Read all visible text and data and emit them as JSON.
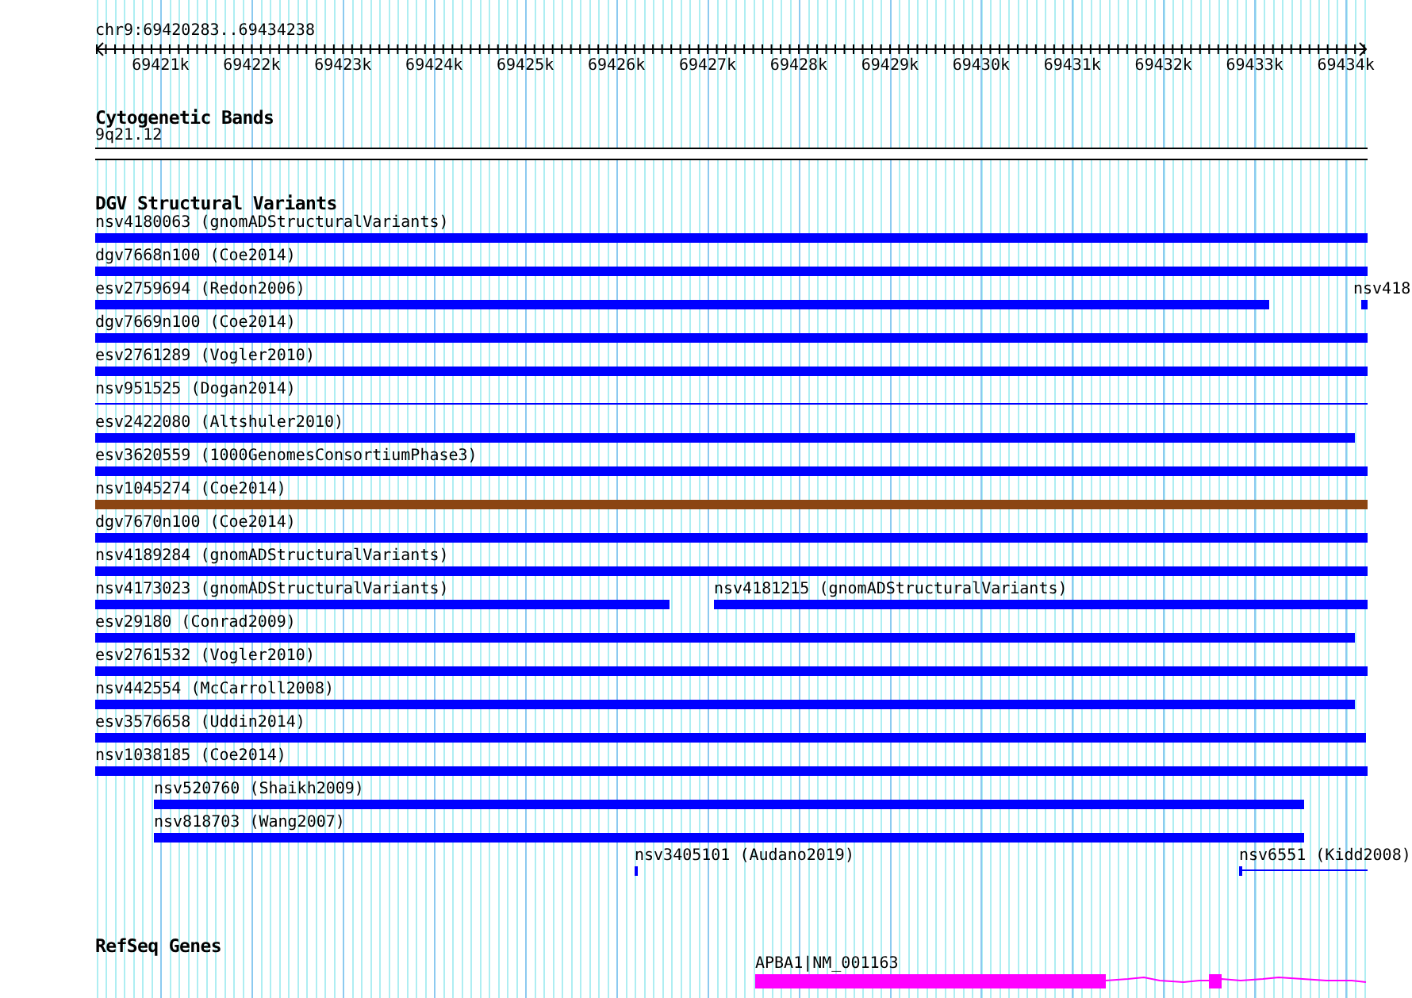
{
  "ruler": {
    "location": "chr9:69420283..69434238",
    "tick_labels": [
      "69421k",
      "69422k",
      "69423k",
      "69424k",
      "69425k",
      "69426k",
      "69427k",
      "69428k",
      "69429k",
      "69430k",
      "69431k",
      "69432k",
      "69433k",
      "69434k"
    ]
  },
  "cytogenetic_bands": {
    "title": "Cytogenetic Bands",
    "band_label": "9q21.12"
  },
  "dgv_structural_variants": {
    "title": "DGV Structural Variants",
    "rows": [
      {
        "features": [
          {
            "label": "nsv4180063 (gnomADStructuralVariants)",
            "kind": "bar",
            "color": "#0000ff"
          }
        ]
      },
      {
        "features": [
          {
            "label": "dgv7668n100 (Coe2014)",
            "kind": "bar",
            "color": "#0000ff"
          }
        ]
      },
      {
        "features": [
          {
            "label": "esv2759694 (Redon2006)",
            "kind": "bar",
            "color": "#0000ff"
          },
          {
            "label": "nsv418",
            "kind": "bar",
            "color": "#0000ff"
          }
        ]
      },
      {
        "features": [
          {
            "label": "dgv7669n100 (Coe2014)",
            "kind": "bar",
            "color": "#0000ff"
          }
        ]
      },
      {
        "features": [
          {
            "label": "esv2761289 (Vogler2010)",
            "kind": "bar",
            "color": "#0000ff"
          }
        ]
      },
      {
        "features": [
          {
            "label": "nsv951525 (Dogan2014)",
            "kind": "line",
            "color": "#0000ff"
          }
        ]
      },
      {
        "features": [
          {
            "label": "esv2422080 (Altshuler2010)",
            "kind": "bar",
            "color": "#0000ff"
          }
        ]
      },
      {
        "features": [
          {
            "label": "esv3620559 (1000GenomesConsortiumPhase3)",
            "kind": "bar",
            "color": "#0000ff"
          }
        ]
      },
      {
        "features": [
          {
            "label": "nsv1045274 (Coe2014)",
            "kind": "bar",
            "color": "#8b4513"
          }
        ]
      },
      {
        "features": [
          {
            "label": "dgv7670n100 (Coe2014)",
            "kind": "bar",
            "color": "#0000ff"
          }
        ]
      },
      {
        "features": [
          {
            "label": "nsv4189284 (gnomADStructuralVariants)",
            "kind": "bar",
            "color": "#0000ff"
          }
        ]
      },
      {
        "features": [
          {
            "label": "nsv4173023 (gnomADStructuralVariants)",
            "kind": "bar",
            "color": "#0000ff"
          },
          {
            "label": "nsv4181215 (gnomADStructuralVariants)",
            "kind": "bar",
            "color": "#0000ff"
          }
        ]
      },
      {
        "features": [
          {
            "label": "esv29180 (Conrad2009)",
            "kind": "bar",
            "color": "#0000ff"
          }
        ]
      },
      {
        "features": [
          {
            "label": "esv2761532 (Vogler2010)",
            "kind": "bar",
            "color": "#0000ff"
          }
        ]
      },
      {
        "features": [
          {
            "label": "nsv442554 (McCarroll2008)",
            "kind": "bar",
            "color": "#0000ff"
          }
        ]
      },
      {
        "features": [
          {
            "label": "esv3576658 (Uddin2014)",
            "kind": "bar",
            "color": "#0000ff"
          }
        ]
      },
      {
        "features": [
          {
            "label": "nsv1038185 (Coe2014)",
            "kind": "bar",
            "color": "#0000ff"
          }
        ]
      },
      {
        "features": [
          {
            "label": "nsv520760 (Shaikh2009)",
            "kind": "bar",
            "color": "#0000ff"
          }
        ]
      },
      {
        "features": [
          {
            "label": "nsv818703 (Wang2007)",
            "kind": "bar",
            "color": "#0000ff"
          }
        ]
      },
      {
        "features": [
          {
            "label": "nsv3405101 (Audano2019)",
            "kind": "bar",
            "color": "#0000ff"
          },
          {
            "label": "nsv6551 (Kidd2008)",
            "kind": "tick-line",
            "color": "#0000ff"
          }
        ]
      }
    ]
  },
  "refseq_genes": {
    "title": "RefSeq Genes",
    "genes": [
      {
        "label": "APBA1|NM_001163",
        "color": "#ff00ff"
      }
    ]
  }
}
